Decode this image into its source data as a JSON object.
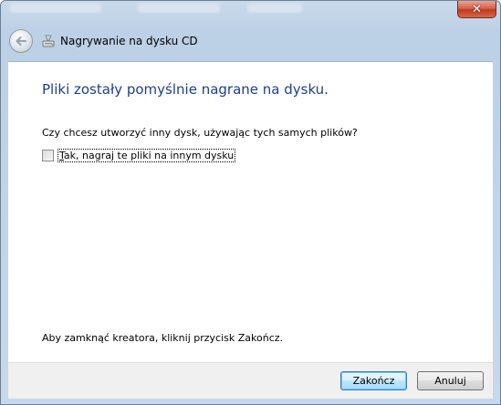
{
  "window": {
    "title": "Nagrywanie na dysku CD",
    "close_label": "✕"
  },
  "icons": {
    "back": "back-arrow-icon",
    "app": "cd-burn-icon",
    "close": "close-icon"
  },
  "content": {
    "heading": "Pliki zostały pomyślnie nagrane na dysku.",
    "question": "Czy chcesz utworzyć inny dysk, używając tych samych plików?",
    "checkbox": {
      "mnemonic": "T",
      "label_rest": "ak, nagraj te pliki na innym dysku",
      "checked": false
    },
    "footer": "Aby zamknąć kreatora, kliknij przycisk Zakończ."
  },
  "buttons": {
    "finish": "Zakończ",
    "cancel": "Anuluj"
  },
  "colors": {
    "heading": "#1e3f8c",
    "default_button_border": "#3c7fb1",
    "close_button": "#c2391f"
  }
}
